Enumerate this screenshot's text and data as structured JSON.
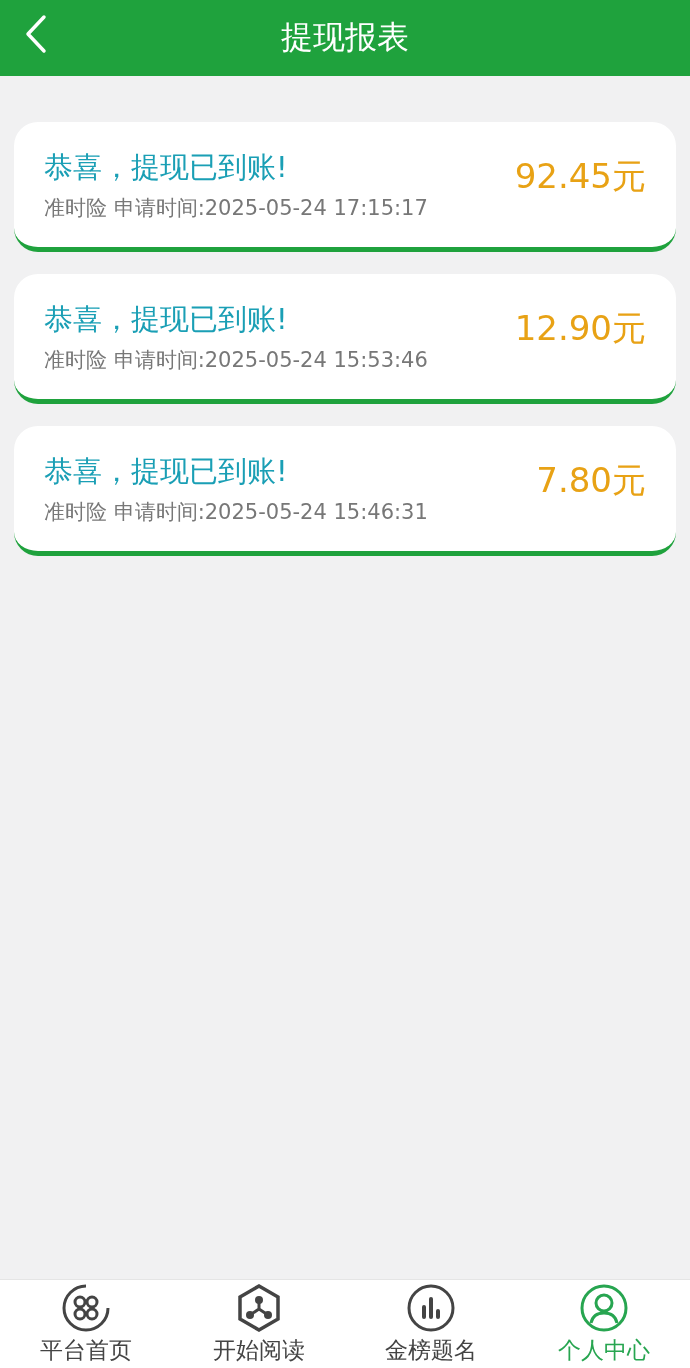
{
  "header": {
    "title": "提现报表"
  },
  "records": [
    {
      "title": "恭喜，提现已到账!",
      "detail": "准时险 申请时间:2025-05-24 17:15:17",
      "amount": "92.45元"
    },
    {
      "title": "恭喜，提现已到账!",
      "detail": "准时险 申请时间:2025-05-24 15:53:46",
      "amount": "12.90元"
    },
    {
      "title": "恭喜，提现已到账!",
      "detail": "准时险 申请时间:2025-05-24 15:46:31",
      "amount": "7.80元"
    }
  ],
  "tabs": [
    {
      "label": "平台首页",
      "kind": "home",
      "selected": false
    },
    {
      "label": "开始阅读",
      "kind": "read",
      "selected": false
    },
    {
      "label": "金榜题名",
      "kind": "rank",
      "selected": false
    },
    {
      "label": "个人中心",
      "kind": "user",
      "selected": true
    }
  ]
}
